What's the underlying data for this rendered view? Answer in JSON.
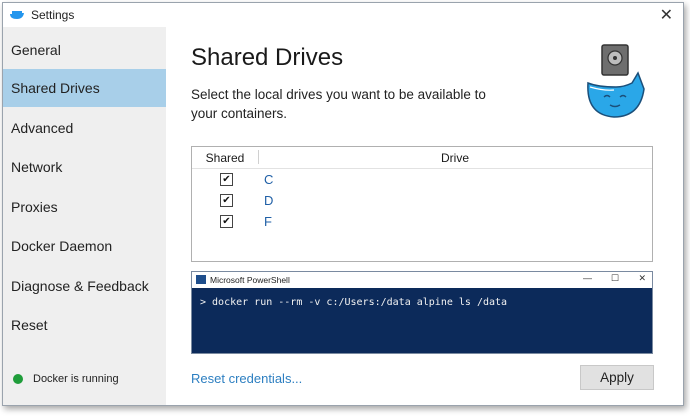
{
  "window": {
    "title": "Settings"
  },
  "sidebar": {
    "items": [
      {
        "label": "General"
      },
      {
        "label": "Shared Drives"
      },
      {
        "label": "Advanced"
      },
      {
        "label": "Network"
      },
      {
        "label": "Proxies"
      },
      {
        "label": "Docker Daemon"
      },
      {
        "label": "Diagnose & Feedback"
      },
      {
        "label": "Reset"
      }
    ],
    "active_item": "Shared Drives",
    "status": {
      "text": "Docker is running",
      "color": "#1f9d3a"
    }
  },
  "main": {
    "title": "Shared Drives",
    "description": "Select the local drives you want to be available to your containers.",
    "drives": {
      "headers": {
        "shared": "Shared",
        "drive": "Drive"
      },
      "rows": [
        {
          "checked": true,
          "letter": "C"
        },
        {
          "checked": true,
          "letter": "D"
        },
        {
          "checked": true,
          "letter": "F"
        }
      ]
    },
    "powershell": {
      "title": "Microsoft PowerShell",
      "command": "> docker run --rm -v c:/Users:/data alpine ls /data"
    },
    "reset_link": "Reset credentials...",
    "apply_label": "Apply"
  },
  "colors": {
    "accent": "#a8cfe9",
    "link": "#2d7fc1",
    "powershell_bg": "#0c2a5a"
  },
  "icons": [
    "docker-whale-icon",
    "close-icon",
    "checkbox-icon",
    "powershell-icon",
    "minimize-icon",
    "maximize-icon"
  ]
}
